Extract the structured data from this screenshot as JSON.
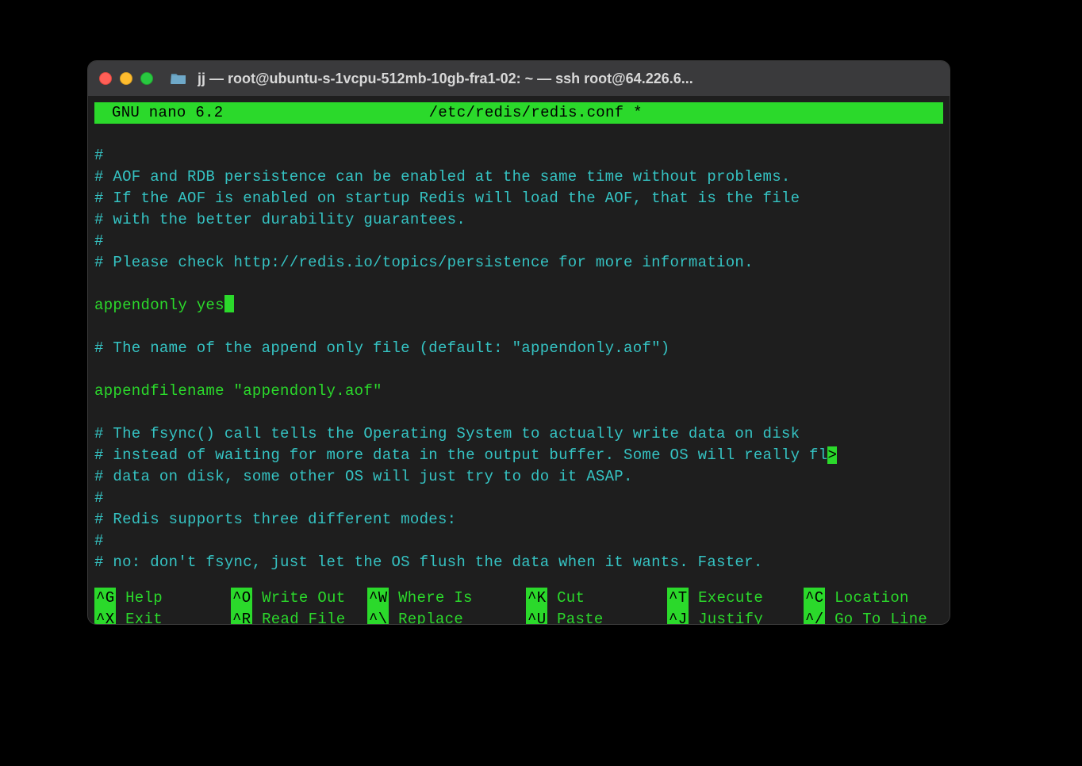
{
  "window": {
    "title": "jj — root@ubuntu-s-1vcpu-512mb-10gb-fra1-02: ~ — ssh root@64.226.6..."
  },
  "nano": {
    "app": "GNU nano 6.2",
    "file": "/etc/redis/redis.conf *"
  },
  "lines": {
    "l01": "#",
    "l02": "# AOF and RDB persistence can be enabled at the same time without problems.",
    "l03": "# If the AOF is enabled on startup Redis will load the AOF, that is the file",
    "l04": "# with the better durability guarantees.",
    "l05": "#",
    "l06": "# Please check http://redis.io/topics/persistence for more information.",
    "l07": "",
    "l08": "appendonly yes",
    "l09": "",
    "l10": "# The name of the append only file (default: \"appendonly.aof\")",
    "l11": "",
    "l12": "appendfilename \"appendonly.aof\"",
    "l13": "",
    "l14": "# The fsync() call tells the Operating System to actually write data on disk",
    "l15": "# instead of waiting for more data in the output buffer. Some OS will really fl",
    "l15_cont": ">",
    "l16": "# data on disk, some other OS will just try to do it ASAP.",
    "l17": "#",
    "l18": "# Redis supports three different modes:",
    "l19": "#",
    "l20": "# no: don't fsync, just let the OS flush the data when it wants. Faster."
  },
  "shortcuts": {
    "row1": [
      {
        "key": "^G",
        "label": " Help"
      },
      {
        "key": "^O",
        "label": " Write Out"
      },
      {
        "key": "^W",
        "label": " Where Is"
      },
      {
        "key": "^K",
        "label": " Cut"
      },
      {
        "key": "^T",
        "label": " Execute"
      },
      {
        "key": "^C",
        "label": " Location"
      }
    ],
    "row2": [
      {
        "key": "^X",
        "label": " Exit"
      },
      {
        "key": "^R",
        "label": " Read File"
      },
      {
        "key": "^\\",
        "label": " Replace"
      },
      {
        "key": "^U",
        "label": " Paste"
      },
      {
        "key": "^J",
        "label": " Justify"
      },
      {
        "key": "^/",
        "label": " Go To Line"
      }
    ]
  }
}
